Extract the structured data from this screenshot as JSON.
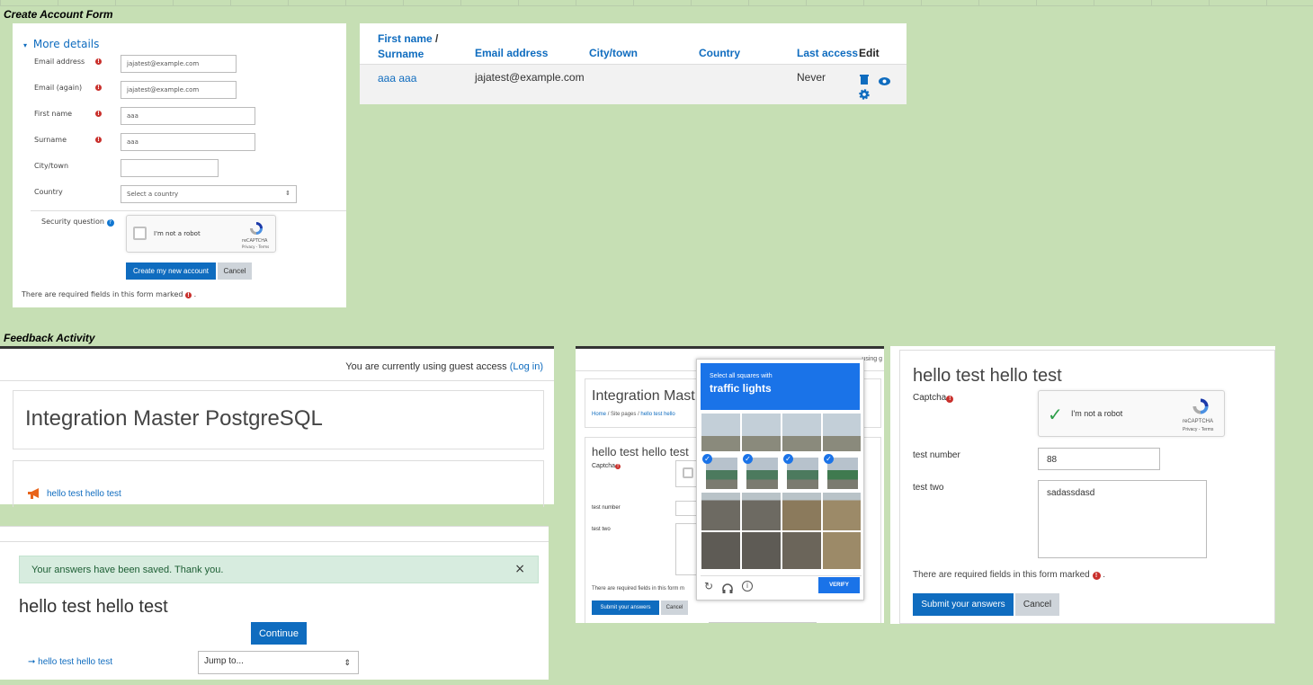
{
  "sections": {
    "create_account": "Create Account Form",
    "feedback": "Feedback Activity"
  },
  "form": {
    "more_details": "More details",
    "email_label": "Email address",
    "email_value": "jajatest@example.com",
    "email_again_label": "Email (again)",
    "email_again_value": "jajatest@example.com",
    "first_name_label": "First name",
    "first_name_value": "aaa",
    "surname_label": "Surname",
    "surname_value": "aaa",
    "city_label": "City/town",
    "city_value": "",
    "country_label": "Country",
    "country_value": "Select a country",
    "security_label": "Security question",
    "recaptcha_text": "I'm not a robot",
    "recaptcha_brand": "reCAPTCHA",
    "recaptcha_terms": "Privacy - Terms",
    "create_button": "Create my new account",
    "cancel_button": "Cancel",
    "required_note": "There are required fields in this form marked"
  },
  "users_table": {
    "headers": {
      "first": "First name",
      "slash": "/",
      "surname": "Surname",
      "email": "Email address",
      "city": "City/town",
      "country": "Country",
      "last_access": "Last access",
      "edit": "Edit"
    },
    "row": {
      "name": "aaa aaa",
      "email": "jajatest@example.com",
      "city": "",
      "country": "",
      "last_access": "Never"
    }
  },
  "guest_page": {
    "guest_text": "You are currently using guest access",
    "login_link": "(Log in)",
    "site_title": "Integration Master PostgreSQL",
    "activity_link": "hello test hello test"
  },
  "saved_page": {
    "alert": "Your answers have been saved. Thank you.",
    "close": "×",
    "title": "hello test hello test",
    "continue": "Continue",
    "back_link": "hello test hello test",
    "jump_to": "Jump to..."
  },
  "captcha_page": {
    "guest_partial": "using g",
    "site_title": "Integration Mast",
    "breadcrumb_home": "Home",
    "breadcrumb_sep": "/",
    "breadcrumb_site": "Site pages",
    "breadcrumb_activity": "hello test hello",
    "title": "hello test hello test",
    "captcha_label": "Captcha",
    "test_number_label": "test number",
    "test_two_label": "test two",
    "required_note": "There are required fields in this form m",
    "submit": "Submit your answers",
    "cancel": "Cancel",
    "challenge_small": "Select all squares with",
    "challenge_big": "traffic lights",
    "verify": "VERIFY"
  },
  "feedback_form": {
    "title": "hello test hello test",
    "captcha_label": "Captcha",
    "recaptcha_text": "I'm not a robot",
    "recaptcha_brand": "reCAPTCHA",
    "recaptcha_terms": "Privacy - Terms",
    "test_number_label": "test number",
    "test_number_value": "88",
    "test_two_label": "test two",
    "test_two_value": "sadassdasd",
    "required_note": "There are required fields in this form marked",
    "submit": "Submit your answers",
    "cancel": "Cancel"
  },
  "colors": {
    "background": "#c6dfb4",
    "primary": "#0f6cbf",
    "required": "#c9302c",
    "captcha_blue": "#1a73e8"
  }
}
